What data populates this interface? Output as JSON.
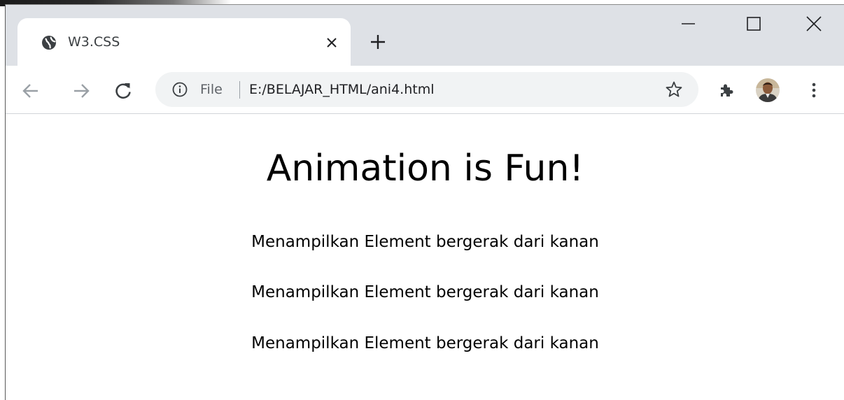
{
  "browser": {
    "tab": {
      "title": "W3.CSS",
      "favicon": "globe-icon"
    },
    "new_tab_icon": "plus-icon",
    "window_controls": [
      "minimize-icon",
      "maximize-icon",
      "close-icon"
    ],
    "nav": {
      "back_icon": "arrow-left-icon",
      "forward_icon": "arrow-right-icon",
      "reload_icon": "reload-icon"
    },
    "omnibox": {
      "scheme_label": "File",
      "url": "E:/BELAJAR_HTML/ani4.html",
      "info_icon": "info-icon",
      "bookmark_icon": "star-icon"
    },
    "toolbar_icons": [
      "puzzle-icon",
      "avatar",
      "kebab-menu-icon"
    ]
  },
  "page": {
    "heading": "Animation is Fun!",
    "lines": [
      "Menampilkan Element bergerak dari kanan",
      "Menampilkan Element bergerak dari kanan",
      "Menampilkan Element bergerak dari kanan"
    ]
  },
  "colors": {
    "tabstrip_bg": "#dee1e6",
    "omnibox_bg": "#f1f3f4",
    "icon_gray": "#5f6368",
    "text_dark": "#202124"
  }
}
